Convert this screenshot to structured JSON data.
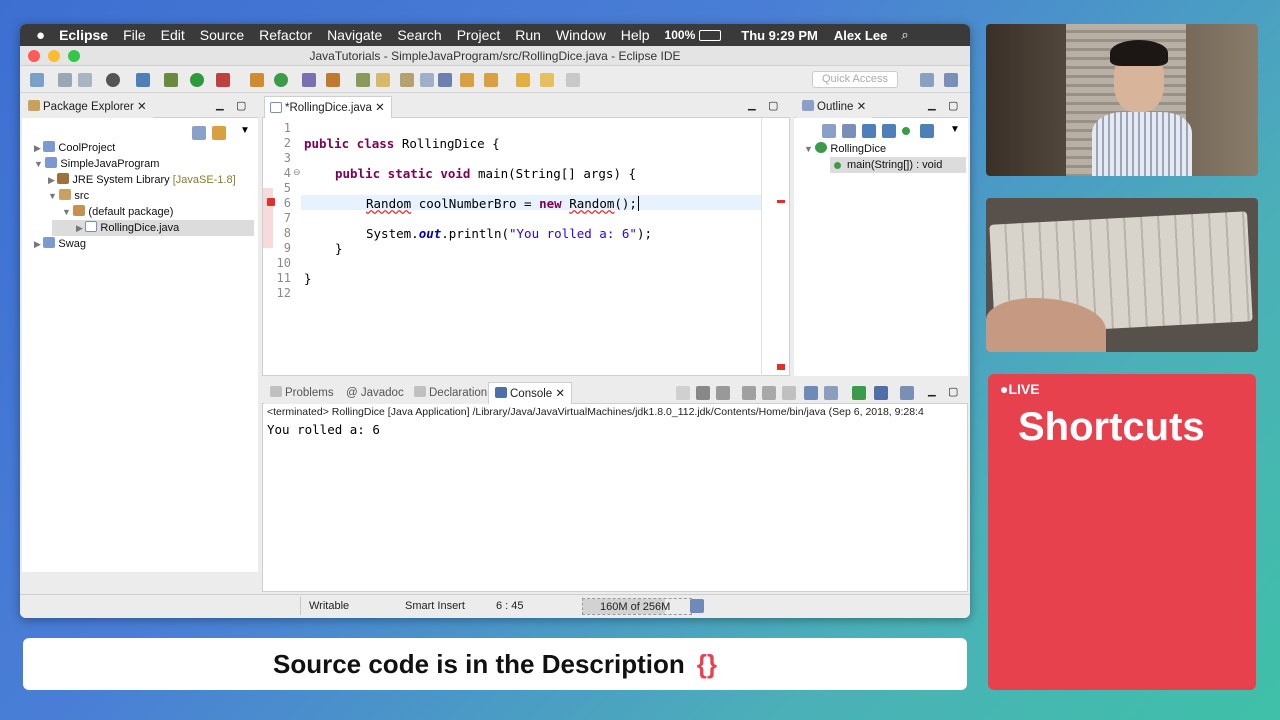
{
  "menubar": {
    "app": "Eclipse",
    "items": [
      "File",
      "Edit",
      "Source",
      "Refactor",
      "Navigate",
      "Search",
      "Project",
      "Run",
      "Window",
      "Help"
    ],
    "battery": "100%",
    "clock": "Thu 9:29 PM",
    "user": "Alex Lee"
  },
  "window": {
    "title": "JavaTutorials - SimpleJavaProgram/src/RollingDice.java - Eclipse IDE"
  },
  "toolbar": {
    "quick_access": "Quick Access"
  },
  "package_explorer": {
    "tab": "Package Explorer",
    "items": [
      "CoolProject",
      "SimpleJavaProgram",
      "JRE System Library",
      "[JavaSE-1.8]",
      "src",
      "(default package)",
      "RollingDice.java",
      "Swag"
    ]
  },
  "editor": {
    "tab": "*RollingDice.java",
    "line_numbers": [
      "1",
      "2",
      "3",
      "4",
      "5",
      "6",
      "7",
      "8",
      "9",
      "10",
      "11",
      "12"
    ],
    "code": {
      "l2_kw": "public class",
      "l2_rest": " RollingDice {",
      "l4_kw": "public static void",
      "l4_rest": " main(String[] args) {",
      "l6_type": "Random",
      "l6_var": "coolNumberBro",
      "l6_eq": " = ",
      "l6_new": "new",
      "l6_cls": "Random",
      "l6_end": "();",
      "l8_a": "System.",
      "l8_out": "out",
      "l8_b": ".println(",
      "l8_str": "\"You rolled a: 6\"",
      "l8_c": ");",
      "l9": "}",
      "l11": "}"
    }
  },
  "outline": {
    "tab": "Outline",
    "class_name": "RollingDice",
    "method": "main(String[]) : void"
  },
  "bottom_tabs": {
    "problems": "Problems",
    "javadoc": "Javadoc",
    "declaration": "Declaration",
    "console": "Console"
  },
  "console": {
    "terminated": "<terminated> RollingDice [Java Application] /Library/Java/JavaVirtualMachines/jdk1.8.0_112.jdk/Contents/Home/bin/java (Sep 6, 2018, 9:28:4",
    "output": "You rolled a: 6"
  },
  "status": {
    "writable": "Writable",
    "insert_mode": "Smart Insert",
    "position": "6 : 45",
    "memory": "160M of 256M"
  },
  "banner": {
    "text": "Source code is in the Description",
    "icon": "{}"
  },
  "live_card": {
    "live": "LIVE",
    "title": "Shortcuts"
  },
  "colors": {
    "red_card": "#e8414e",
    "keyword": "#7f0055",
    "string": "#2a00ff"
  }
}
